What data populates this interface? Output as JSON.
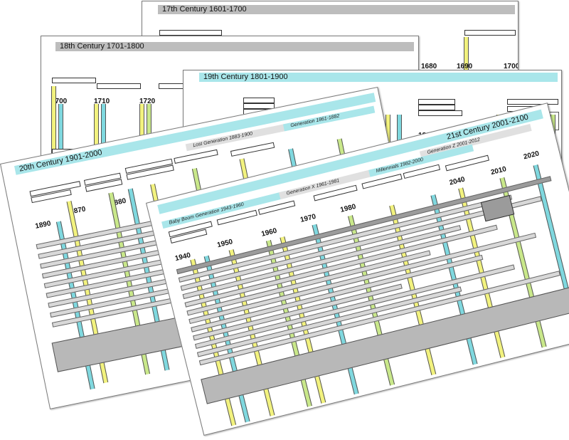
{
  "colors": {
    "yellow_line": "#f2f27e",
    "cyan_line": "#7fd8df",
    "green_line": "#c9e88a",
    "gray_bar": "#bdbdbd",
    "cyan_bar": "#a9e6ea",
    "dark_base": "#9b9b9b"
  },
  "sheets": [
    {
      "id": "c17",
      "title": "17th Century  1601-1700",
      "years": [
        "1680",
        "1690",
        "1700"
      ]
    },
    {
      "id": "c18",
      "title": "18th Century  1701-1800",
      "years": [
        "1700",
        "1710",
        "1720"
      ]
    },
    {
      "id": "c19",
      "title": "19th Century  1801-1900",
      "years": [
        "1880",
        "1890"
      ]
    },
    {
      "id": "c20",
      "title": "20th Century  1901-2000",
      "years": [
        "1890",
        "1870",
        "1880"
      ],
      "eras": [
        "Lost Generation 1883-1900",
        "Generation 1861-1882"
      ]
    },
    {
      "id": "c21",
      "title": "21st Century  2001-2100",
      "years": [
        "1940",
        "1950",
        "1960",
        "1970",
        "1980",
        "2010",
        "2020",
        "2040"
      ],
      "eras": [
        "Generation Z 2001-2012",
        "Baby Boom Generation 1943-1960",
        "Generation X 1961-1981",
        "Millennials 1982-2000"
      ]
    }
  ]
}
